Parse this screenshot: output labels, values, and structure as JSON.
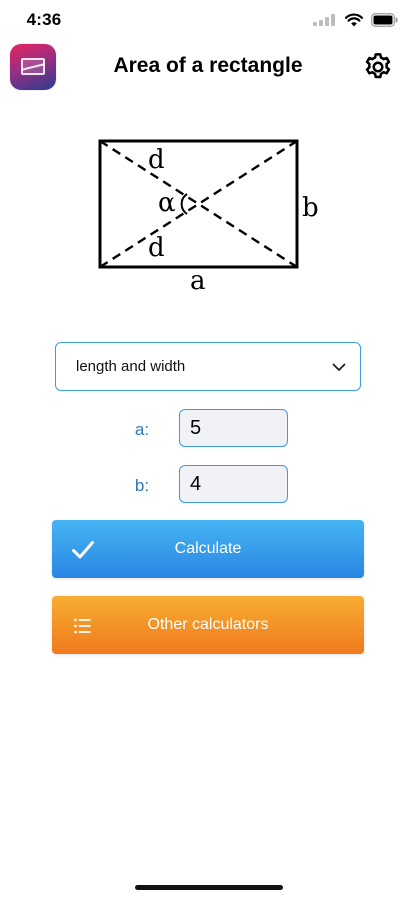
{
  "status_bar": {
    "time": "4:36"
  },
  "header": {
    "title": "Area of a rectangle",
    "app_icon": "rectangle-app-icon",
    "settings_icon": "gear-icon"
  },
  "diagram": {
    "label_d_top": "d",
    "label_alpha": "α",
    "label_d_bottom": "d",
    "label_b": "b",
    "label_a": "a"
  },
  "mode_select": {
    "selected": "length and width",
    "icon": "chevron-down-icon"
  },
  "inputs": {
    "a": {
      "label": "a:",
      "value": "5"
    },
    "b": {
      "label": "b:",
      "value": "4"
    }
  },
  "buttons": {
    "calculate": {
      "label": "Calculate",
      "icon": "checkmark-icon"
    },
    "other": {
      "label": "Other calculators",
      "icon": "list-icon"
    }
  },
  "colors": {
    "accent_blue": "#3d9be0",
    "calculate_button": "#2f93eb",
    "other_button": "#f38f26",
    "label_blue": "#2f78b8"
  }
}
